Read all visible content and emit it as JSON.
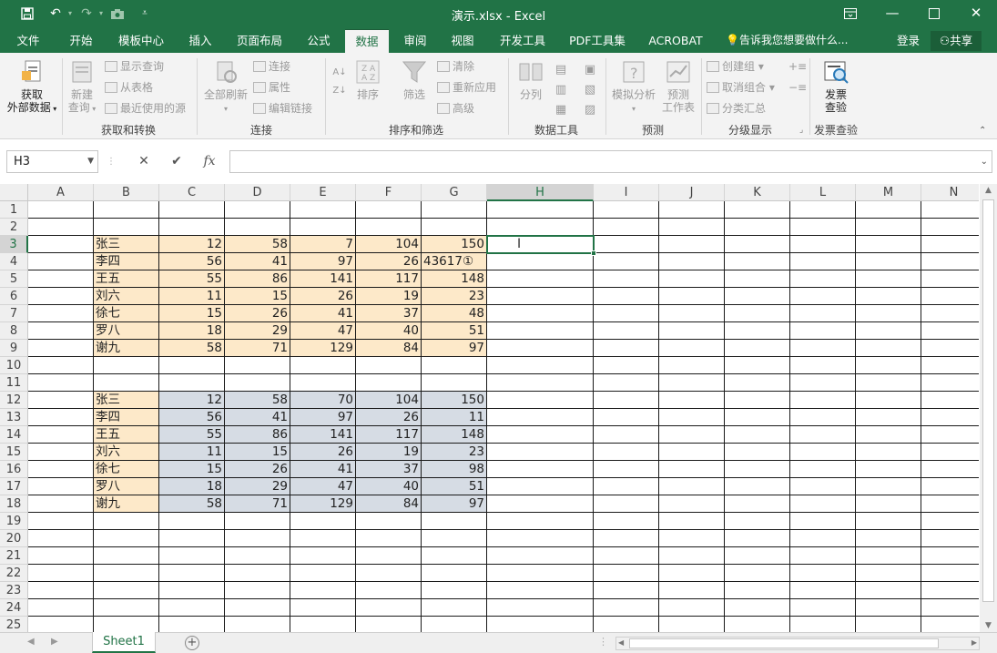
{
  "app": {
    "title": "演示.xlsx - Excel",
    "colors": {
      "accent": "#217346",
      "peach": "#fde9c9",
      "gray": "#d6dce4"
    }
  },
  "quick_access": {
    "save_icon": "save-icon",
    "undo_icon": "undo-icon",
    "redo_icon": "redo-icon",
    "camera_icon": "camera-icon",
    "customize_icon": "customize-icon"
  },
  "window_buttons": {
    "ribbon_options": "ribbon-display-options-icon",
    "minimize": "minimize-icon",
    "maximize": "maximize-icon",
    "close": "close-icon"
  },
  "tabs": [
    {
      "label": "文件"
    },
    {
      "label": "开始"
    },
    {
      "label": "模板中心"
    },
    {
      "label": "插入"
    },
    {
      "label": "页面布局"
    },
    {
      "label": "公式"
    },
    {
      "label": "数据",
      "active": true
    },
    {
      "label": "审阅"
    },
    {
      "label": "视图"
    },
    {
      "label": "开发工具"
    },
    {
      "label": "PDF工具集"
    },
    {
      "label": "ACROBAT"
    }
  ],
  "tell_me": "告诉我您想要做什么...",
  "login": "登录",
  "share": "共享",
  "ribbon": {
    "get_external": {
      "line1": "获取",
      "line2": "外部数据"
    },
    "new_query": {
      "line1": "新建",
      "line2": "查询"
    },
    "show_queries": "显示查询",
    "from_table": "从表格",
    "recent_sources": "最近使用的源",
    "group_get": "获取和转换",
    "refresh_all": "全部刷新",
    "connections": "连接",
    "properties": "属性",
    "edit_links": "编辑链接",
    "group_conn": "连接",
    "sort": "排序",
    "filter": "筛选",
    "clear": "清除",
    "reapply": "重新应用",
    "advanced": "高级",
    "group_sort": "排序和筛选",
    "split": "分列",
    "group_tools": "数据工具",
    "whatif": "模拟分析",
    "forecast": {
      "line1": "预测",
      "line2": "工作表"
    },
    "group_forecast": "预测",
    "group_btn": "创建组",
    "ungroup": "取消组合",
    "subtotal": "分类汇总",
    "group_outline": "分级显示",
    "invoice": {
      "line1": "发票",
      "line2": "查验"
    },
    "group_invoice": "发票查验"
  },
  "formula_bar": {
    "name_box": "H3",
    "cancel": "✕",
    "enter": "✔",
    "fx": "fx",
    "formula": ""
  },
  "columns": [
    "A",
    "B",
    "C",
    "D",
    "E",
    "F",
    "G",
    "H",
    "I",
    "J",
    "K",
    "L",
    "M",
    "N"
  ],
  "rows": [
    "1",
    "2",
    "3",
    "4",
    "5",
    "6",
    "7",
    "8",
    "9",
    "10",
    "11",
    "12",
    "13",
    "14",
    "15",
    "16",
    "17",
    "18",
    "19",
    "20",
    "21",
    "22",
    "23",
    "24",
    "25"
  ],
  "table1": [
    {
      "name": "张三",
      "c": "12",
      "d": "58",
      "e": "7",
      "f": "104",
      "g": "150"
    },
    {
      "name": "李四",
      "c": "56",
      "d": "41",
      "e": "97",
      "f": "26",
      "g": "43617①"
    },
    {
      "name": "王五",
      "c": "55",
      "d": "86",
      "e": "141",
      "f": "117",
      "g": "148"
    },
    {
      "name": "刘六",
      "c": "11",
      "d": "15",
      "e": "26",
      "f": "19",
      "g": "23"
    },
    {
      "name": "徐七",
      "c": "15",
      "d": "26",
      "e": "41",
      "f": "37",
      "g": "48"
    },
    {
      "name": "罗八",
      "c": "18",
      "d": "29",
      "e": "47",
      "f": "40",
      "g": "51"
    },
    {
      "name": "谢九",
      "c": "58",
      "d": "71",
      "e": "129",
      "f": "84",
      "g": "97"
    }
  ],
  "table2": [
    {
      "name": "张三",
      "c": "12",
      "d": "58",
      "e": "70",
      "f": "104",
      "g": "150"
    },
    {
      "name": "李四",
      "c": "56",
      "d": "41",
      "e": "97",
      "f": "26",
      "g": "11"
    },
    {
      "name": "王五",
      "c": "55",
      "d": "86",
      "e": "141",
      "f": "117",
      "g": "148"
    },
    {
      "name": "刘六",
      "c": "11",
      "d": "15",
      "e": "26",
      "f": "19",
      "g": "23"
    },
    {
      "name": "徐七",
      "c": "15",
      "d": "26",
      "e": "41",
      "f": "37",
      "g": "98"
    },
    {
      "name": "罗八",
      "c": "18",
      "d": "29",
      "e": "47",
      "f": "40",
      "g": "51"
    },
    {
      "name": "谢九",
      "c": "58",
      "d": "71",
      "e": "129",
      "f": "84",
      "g": "97"
    }
  ],
  "selected": {
    "col": "H",
    "row": "3"
  },
  "sheet_tab": "Sheet1"
}
